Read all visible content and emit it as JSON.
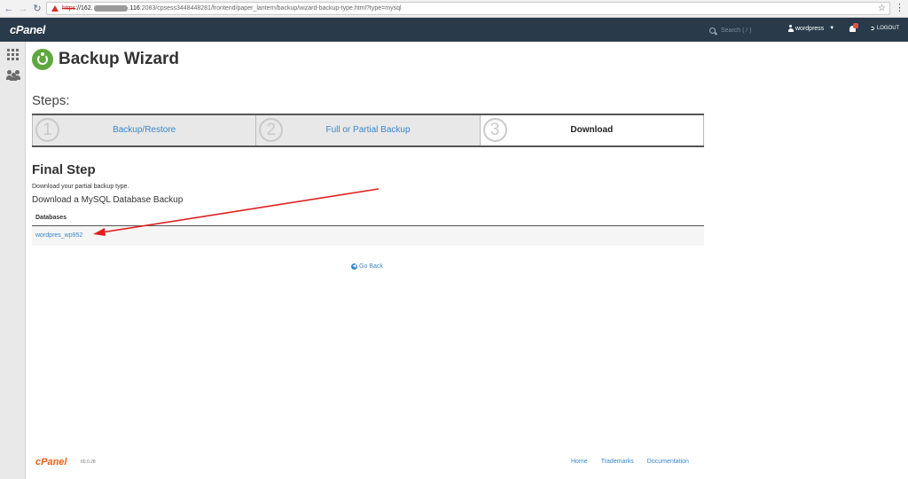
{
  "browser": {
    "url_scheme": "https",
    "url_host_start": "://162.",
    "url_host_end": ".116",
    "url_path": ":2083/cpsess3448448281/frontend/paper_lantern/backup/wizard-backup-type.html?type=mysql"
  },
  "header": {
    "logo": "cPanel",
    "search_placeholder": "Search ( / )",
    "username": "wordpress",
    "logout": "LOGOUT"
  },
  "page": {
    "title": "Backup Wizard",
    "steps_heading": "Steps:",
    "steps": [
      {
        "number": "1",
        "label": "Backup/Restore",
        "active": false
      },
      {
        "number": "2",
        "label": "Full or Partial Backup",
        "active": false
      },
      {
        "number": "3",
        "label": "Download",
        "active": true
      }
    ],
    "final_heading": "Final Step",
    "final_desc": "Download your partial backup type.",
    "download_heading": "Download a MySQL Database Backup",
    "table_header": "Databases",
    "databases": [
      "wordpres_wp952"
    ],
    "go_back": "Go Back"
  },
  "footer": {
    "logo": "cPanel",
    "version": "60.0.28",
    "links": [
      "Home",
      "Trademarks",
      "Documentation"
    ]
  },
  "colors": {
    "header_bg": "#293a4a",
    "link": "#3a87c8",
    "annotation": "#e02020",
    "brand_orange": "#e8621a"
  }
}
